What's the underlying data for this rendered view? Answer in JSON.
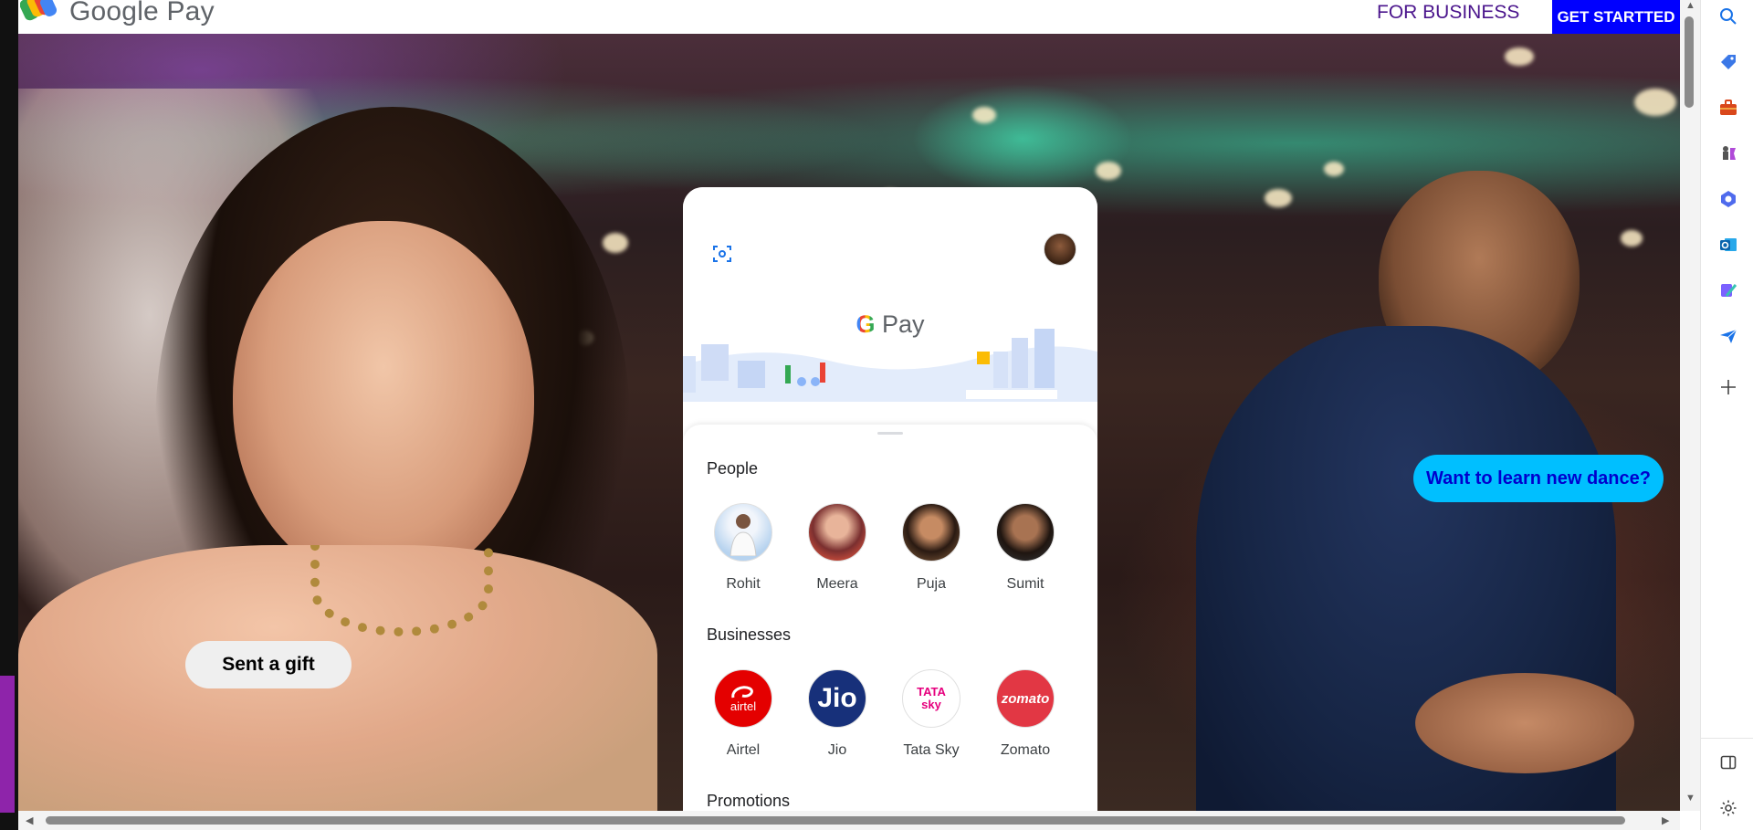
{
  "nav": {
    "brand": "Google Pay",
    "for_business": "FOR BUSINESS",
    "get_started": "GET STARTTED"
  },
  "hero": {
    "gift_button": "Sent a gift",
    "dance_button": "Want to learn new dance?"
  },
  "phone": {
    "logo_g": "G",
    "logo_pay": " Pay",
    "people_title": "People",
    "people": [
      {
        "name": "Rohit"
      },
      {
        "name": "Meera"
      },
      {
        "name": "Puja"
      },
      {
        "name": "Sumit"
      }
    ],
    "businesses_title": "Businesses",
    "businesses": [
      {
        "name": "Airtel",
        "logo_text": "airtel",
        "color": "#e40000"
      },
      {
        "name": "Jio",
        "logo_text": "Jio",
        "color": "#0f3cc9"
      },
      {
        "name": "Tata Sky",
        "logo_text": "TATA sky",
        "color": "#e6007e"
      },
      {
        "name": "Zomato",
        "logo_text": "zomato",
        "color": "#e23744"
      }
    ],
    "promotions_title": "Promotions"
  },
  "colors": {
    "get_started_bg": "#0000ff",
    "for_business_text": "#4a148c",
    "dance_button_bg": "#00bfff",
    "dance_button_text": "#0000cd"
  },
  "sidebar_icons": [
    "search-icon",
    "tag-icon",
    "briefcase-icon",
    "chess-icon",
    "copilot-icon",
    "outlook-icon",
    "designer-icon",
    "send-icon",
    "add-icon",
    "split-view-icon",
    "settings-icon"
  ]
}
